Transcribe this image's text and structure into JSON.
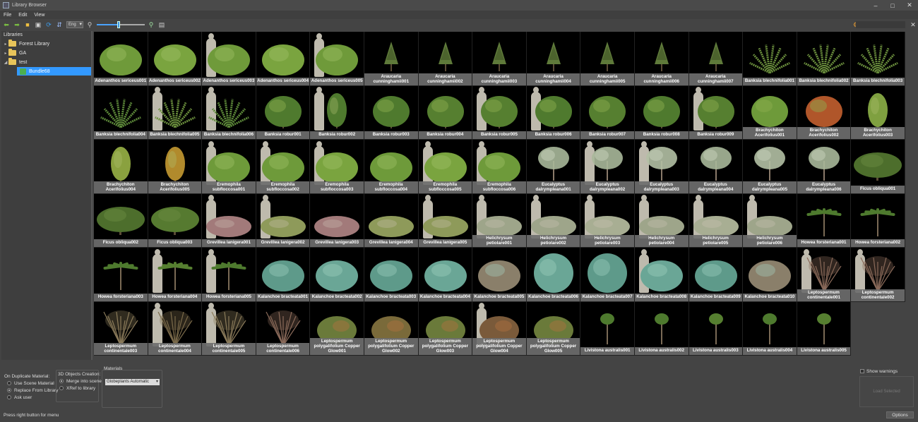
{
  "window": {
    "title": "Library Browser"
  },
  "menu": [
    "File",
    "Edit",
    "View"
  ],
  "toolbar": {
    "language": "Eng",
    "zoom_fraction": 0.45
  },
  "libraries": {
    "title": "Libraries",
    "items": [
      {
        "label": "Forest Library"
      },
      {
        "label": "GA"
      },
      {
        "label": "test"
      },
      {
        "label": "Bundle68"
      }
    ]
  },
  "tiles": [
    {
      "label": "Adenanthos sericeus001",
      "kind": "shrub",
      "color": "#6f9a3a"
    },
    {
      "label": "Adenanthos sericeus002",
      "kind": "shrub",
      "color": "#7aa43f"
    },
    {
      "label": "Adenanthos sericeus003",
      "kind": "shrub",
      "color": "#6f9a3a",
      "sil": true
    },
    {
      "label": "Adenanthos sericeus004",
      "kind": "shrub",
      "color": "#7aa43f"
    },
    {
      "label": "Adenanthos sericeus005",
      "kind": "shrub",
      "color": "#6f9a3a",
      "sil": true
    },
    {
      "label": "Araucaria cunninghamii001",
      "kind": "conifer",
      "color": "#5f7a3a"
    },
    {
      "label": "Araucaria cunninghamii002",
      "kind": "conifer",
      "color": "#5f7a3a"
    },
    {
      "label": "Araucaria cunninghamii003",
      "kind": "conifer",
      "color": "#5f7a3a"
    },
    {
      "label": "Araucaria cunninghamii004",
      "kind": "conifer",
      "color": "#5f7a3a"
    },
    {
      "label": "Araucaria cunninghamii005",
      "kind": "conifer",
      "color": "#5f7a3a"
    },
    {
      "label": "Araucaria cunninghamii006",
      "kind": "conifer",
      "color": "#5f7a3a"
    },
    {
      "label": "Araucaria cunninghamii007",
      "kind": "conifer",
      "color": "#5f7a3a"
    },
    {
      "label": "Banksia blechnifolia001",
      "kind": "fern",
      "color": "#6b8f3d"
    },
    {
      "label": "Banksia blechnifolia002",
      "kind": "fern",
      "color": "#6b8f3d"
    },
    {
      "label": "Banksia blechnifolia003",
      "kind": "fern",
      "color": "#6b8f3d"
    },
    {
      "label": "Banksia blechnifolia004",
      "kind": "fern",
      "color": "#5e8a3a"
    },
    {
      "label": "Banksia blechnifolia005",
      "kind": "fern",
      "color": "#6b8f3d",
      "sil": true
    },
    {
      "label": "Banksia blechnifolia006",
      "kind": "fern",
      "color": "#5e8a3a",
      "sil": true
    },
    {
      "label": "Banksia robur001",
      "kind": "broad",
      "color": "#4f7a2e"
    },
    {
      "label": "Banksia robur002",
      "kind": "tall",
      "color": "#4f7a2e",
      "sil": true
    },
    {
      "label": "Banksia robur003",
      "kind": "broad",
      "color": "#4f7a2e"
    },
    {
      "label": "Banksia robur004",
      "kind": "broad",
      "color": "#567f30"
    },
    {
      "label": "Banksia robur005",
      "kind": "broad",
      "color": "#567f30",
      "sil": true
    },
    {
      "label": "Banksia robur006",
      "kind": "bushy",
      "color": "#4f7a2e",
      "sil": true
    },
    {
      "label": "Banksia robur007",
      "kind": "bushy",
      "color": "#567f30"
    },
    {
      "label": "Banksia robur008",
      "kind": "bushy",
      "color": "#4f7a2e"
    },
    {
      "label": "Banksia robur009",
      "kind": "bushy",
      "color": "#567f30",
      "sil": true
    },
    {
      "label": "Brachychiton Acerifolius001",
      "kind": "bushy",
      "color": "#6e9a3a"
    },
    {
      "label": "Brachychiton Acerifolius002",
      "kind": "bushy",
      "color": "#b0562a"
    },
    {
      "label": "Brachychiton Acerifolius003",
      "kind": "tall",
      "color": "#7fa040"
    },
    {
      "label": "Brachychiton Acerifolius004",
      "kind": "tall",
      "color": "#8aa13f"
    },
    {
      "label": "Brachychiton Acerifolius005",
      "kind": "tall",
      "color": "#b18a2c"
    },
    {
      "label": "Eremophila subfloccosa001",
      "kind": "shrub",
      "color": "#6e9a3a",
      "sil": true
    },
    {
      "label": "Eremophila subfloccosa002",
      "kind": "shrub",
      "color": "#6e9a3a",
      "sil": true
    },
    {
      "label": "Eremophila subfloccosa003",
      "kind": "shrub",
      "color": "#7aa43f",
      "sil": true
    },
    {
      "label": "Eremophila subfloccosa004",
      "kind": "shrub",
      "color": "#6e9a3a"
    },
    {
      "label": "Eremophila subfloccosa005",
      "kind": "shrub",
      "color": "#7aa43f",
      "sil": true
    },
    {
      "label": "Eremophila subfloccosa006",
      "kind": "shrub",
      "color": "#6e9a3a",
      "sil": true
    },
    {
      "label": "Eucalyptus dalrympleana001",
      "kind": "gum",
      "color": "#a9b89a"
    },
    {
      "label": "Eucalyptus dalrympleana002",
      "kind": "gum",
      "color": "#a9b89a",
      "sil": true
    },
    {
      "label": "Eucalyptus dalrympleana003",
      "kind": "gum",
      "color": "#b3c0a4",
      "sil": true
    },
    {
      "label": "Eucalyptus dalrympleana004",
      "kind": "gum",
      "color": "#a9b89a"
    },
    {
      "label": "Eucalyptus dalrympleana005",
      "kind": "gum",
      "color": "#b3c0a4"
    },
    {
      "label": "Eucalyptus dalrympleana006",
      "kind": "gum",
      "color": "#a9b89a"
    },
    {
      "label": "Ficus obliqua001",
      "kind": "spread",
      "color": "#4d6e2c"
    },
    {
      "label": "Ficus obliqua002",
      "kind": "spread",
      "color": "#4d6e2c"
    },
    {
      "label": "Ficus obliqua003",
      "kind": "spread",
      "color": "#567a30"
    },
    {
      "label": "Grevillea lanigera001",
      "kind": "low",
      "color": "#a27a7a",
      "sil": true
    },
    {
      "label": "Grevillea lanigera002",
      "kind": "low",
      "color": "#8e9a5a",
      "sil": true
    },
    {
      "label": "Grevillea lanigera003",
      "kind": "low",
      "color": "#a27a7a"
    },
    {
      "label": "Grevillea lanigera004",
      "kind": "low",
      "color": "#8e9a5a"
    },
    {
      "label": "Grevillea lanigera005",
      "kind": "low",
      "color": "#8e9a5a",
      "sil": true
    },
    {
      "label": "Helichrysum petiolare001",
      "kind": "low",
      "color": "#9ea58a",
      "sil": true
    },
    {
      "label": "Helichrysum petiolare002",
      "kind": "low",
      "color": "#9ea58a",
      "sil": true
    },
    {
      "label": "Helichrysum petiolare003",
      "kind": "low",
      "color": "#a8ae93",
      "sil": true
    },
    {
      "label": "Helichrysum petiolare004",
      "kind": "low",
      "color": "#9ea58a",
      "sil": true
    },
    {
      "label": "Helichrysum petiolare005",
      "kind": "low",
      "color": "#a8ae93",
      "sil": true
    },
    {
      "label": "Helichrysum petiolare006",
      "kind": "low",
      "color": "#9ea58a",
      "sil": true
    },
    {
      "label": "Howea forsteriana001",
      "kind": "palm",
      "color": "#4e7a2e"
    },
    {
      "label": "Howea forsteriana002",
      "kind": "palm",
      "color": "#4e7a2e"
    },
    {
      "label": "Howea forsteriana003",
      "kind": "palm",
      "color": "#4e7a2e"
    },
    {
      "label": "Howea forsteriana004",
      "kind": "palm",
      "color": "#567f30",
      "sil": true
    },
    {
      "label": "Howea forsteriana005",
      "kind": "palm",
      "color": "#4e7a2e",
      "sil": true
    },
    {
      "label": "Kalanchoe bracteata001",
      "kind": "blue",
      "color": "#5e9a8a"
    },
    {
      "label": "Kalanchoe bracteata002",
      "kind": "blue",
      "color": "#6aa696"
    },
    {
      "label": "Kalanchoe bracteata003",
      "kind": "blue",
      "color": "#5e9a8a"
    },
    {
      "label": "Kalanchoe bracteata004",
      "kind": "blue",
      "color": "#6aa696"
    },
    {
      "label": "Kalanchoe bracteata005",
      "kind": "blue",
      "color": "#8a7f6a"
    },
    {
      "label": "Kalanchoe bracteata006",
      "kind": "blueball",
      "color": "#6aa696"
    },
    {
      "label": "Kalanchoe bracteata007",
      "kind": "blueball",
      "color": "#5e9a8a"
    },
    {
      "label": "Kalanchoe bracteata008",
      "kind": "blue",
      "color": "#6aa696",
      "sil": true
    },
    {
      "label": "Kalanchoe bracteata009",
      "kind": "blue",
      "color": "#5e9a8a"
    },
    {
      "label": "Kalanchoe bracteata010",
      "kind": "blue",
      "color": "#8a7f6a"
    },
    {
      "label": "Leptospermum continentale001",
      "kind": "sparse",
      "color": "#8a6a5a",
      "sil": true
    },
    {
      "label": "Leptospermum continentale002",
      "kind": "sparse",
      "color": "#8a6a5a",
      "sil": true
    },
    {
      "label": "Leptospermum continentale003",
      "kind": "sparse",
      "color": "#8a7a5a"
    },
    {
      "label": "Leptospermum continentale004",
      "kind": "sparse",
      "color": "#7a6a4a",
      "sil": true
    },
    {
      "label": "Leptospermum continentale005",
      "kind": "sparse",
      "color": "#8a7a5a",
      "sil": true
    },
    {
      "label": "Leptospermum continentale006",
      "kind": "sparse",
      "color": "#8a6a5a"
    },
    {
      "label": "Leptospermum polygalifolium Copper Glow001",
      "kind": "copper",
      "color": "#6a7a3a"
    },
    {
      "label": "Leptospermum polygalifolium Copper Glow002",
      "kind": "copper",
      "color": "#7a6a3a"
    },
    {
      "label": "Leptospermum polygalifolium Copper Glow003",
      "kind": "copper",
      "color": "#6a7a3a"
    },
    {
      "label": "Leptospermum polygalifolium Copper Glow004",
      "kind": "copper",
      "color": "#7a5a3a",
      "sil": true
    },
    {
      "label": "Leptospermum polygalifolium Copper Glow005",
      "kind": "copper",
      "color": "#6a7a3a"
    },
    {
      "label": "Livistona australis001",
      "kind": "fanpalm",
      "color": "#4e7a2e"
    },
    {
      "label": "Livistona australis002",
      "kind": "fanpalm",
      "color": "#4e7a2e"
    },
    {
      "label": "Livistona australis003",
      "kind": "fanpalm",
      "color": "#567f30"
    },
    {
      "label": "Livistona australis004",
      "kind": "fanpalm",
      "color": "#4e7a2e"
    },
    {
      "label": "Livistona australis005",
      "kind": "fanpalm",
      "color": "#567f30"
    }
  ],
  "duplicate_material": {
    "title": "On Duplicate Material:",
    "options": [
      {
        "label": "Use Scene Material",
        "selected": false
      },
      {
        "label": "Replace From Library",
        "selected": true
      },
      {
        "label": "Ask user",
        "selected": false
      }
    ]
  },
  "objects_creation": {
    "title": "3D Objects Creation:",
    "options": [
      {
        "label": "Merge into scene",
        "selected": true
      },
      {
        "label": "XRef to library",
        "selected": false
      }
    ]
  },
  "materials": {
    "title": "Materials",
    "value": "Globeplants Automatic"
  },
  "warnings": {
    "label": "Show warnings"
  },
  "buttons": {
    "load_selected": "Load Selected",
    "options": "Options"
  },
  "status": "Press right button for menu"
}
